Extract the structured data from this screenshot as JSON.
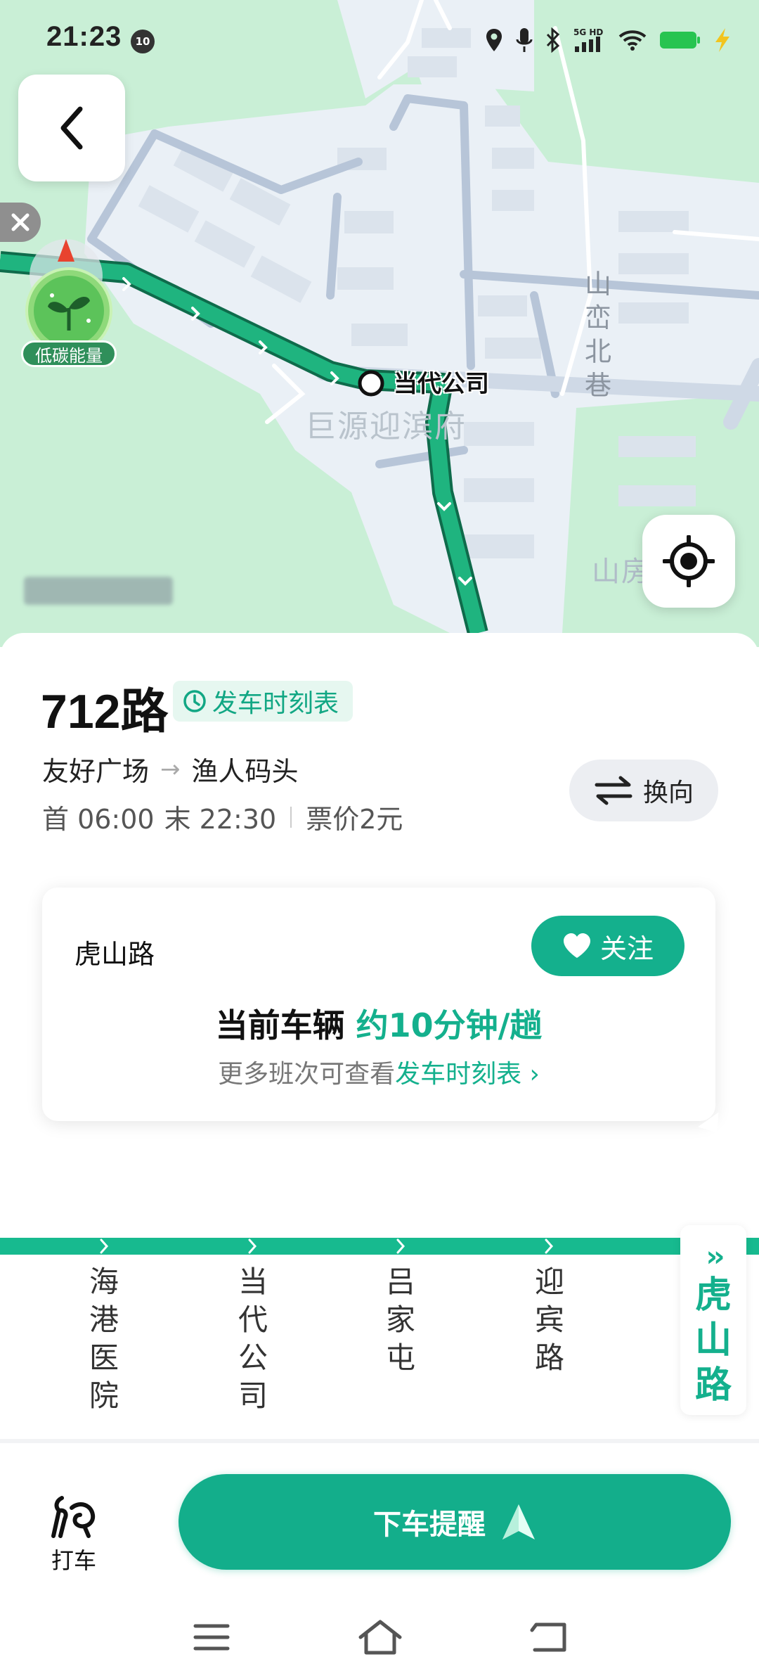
{
  "status_bar": {
    "time": "21:23",
    "notification_badge": "10",
    "icons": [
      "location-icon",
      "microphone-icon",
      "bluetooth-icon",
      "signal-5g-icon",
      "wifi-icon",
      "battery-icon",
      "charging-icon"
    ],
    "network_label": "5G HD"
  },
  "map": {
    "current_stop_label": "当代公司",
    "poi_label": "巨源迎滨府",
    "street_label": "山峦北巷",
    "poi_label_2": "山房公",
    "eco_badge_label": "低碳能量",
    "colors": {
      "route": "#1fb47f",
      "background": "#c9efd6",
      "road": "#dfe6ef"
    }
  },
  "route": {
    "name": "712路",
    "schedule_label": "发车时刻表",
    "from": "友好广场",
    "to": "渔人码头",
    "first_bus": "首 06:00",
    "last_bus": "末 22:30",
    "fare": "票价2元",
    "switch_label": "换向"
  },
  "stop_card": {
    "stop_name": "虎山路",
    "follow_label": "关注",
    "vehicle_prefix": "当前车辆",
    "frequency": "约10分钟/趟",
    "more_text": "更多班次可查看",
    "more_link": "发车时刻表"
  },
  "stops": [
    {
      "name": "海港医院"
    },
    {
      "name": "当代公司"
    },
    {
      "name": "吕家屯"
    },
    {
      "name": "迎宾路"
    }
  ],
  "current_stop": {
    "name": "虎山路"
  },
  "actions": {
    "taxi_label": "打车",
    "alert_label": "下车提醒"
  },
  "accent_color": "#14b08d"
}
